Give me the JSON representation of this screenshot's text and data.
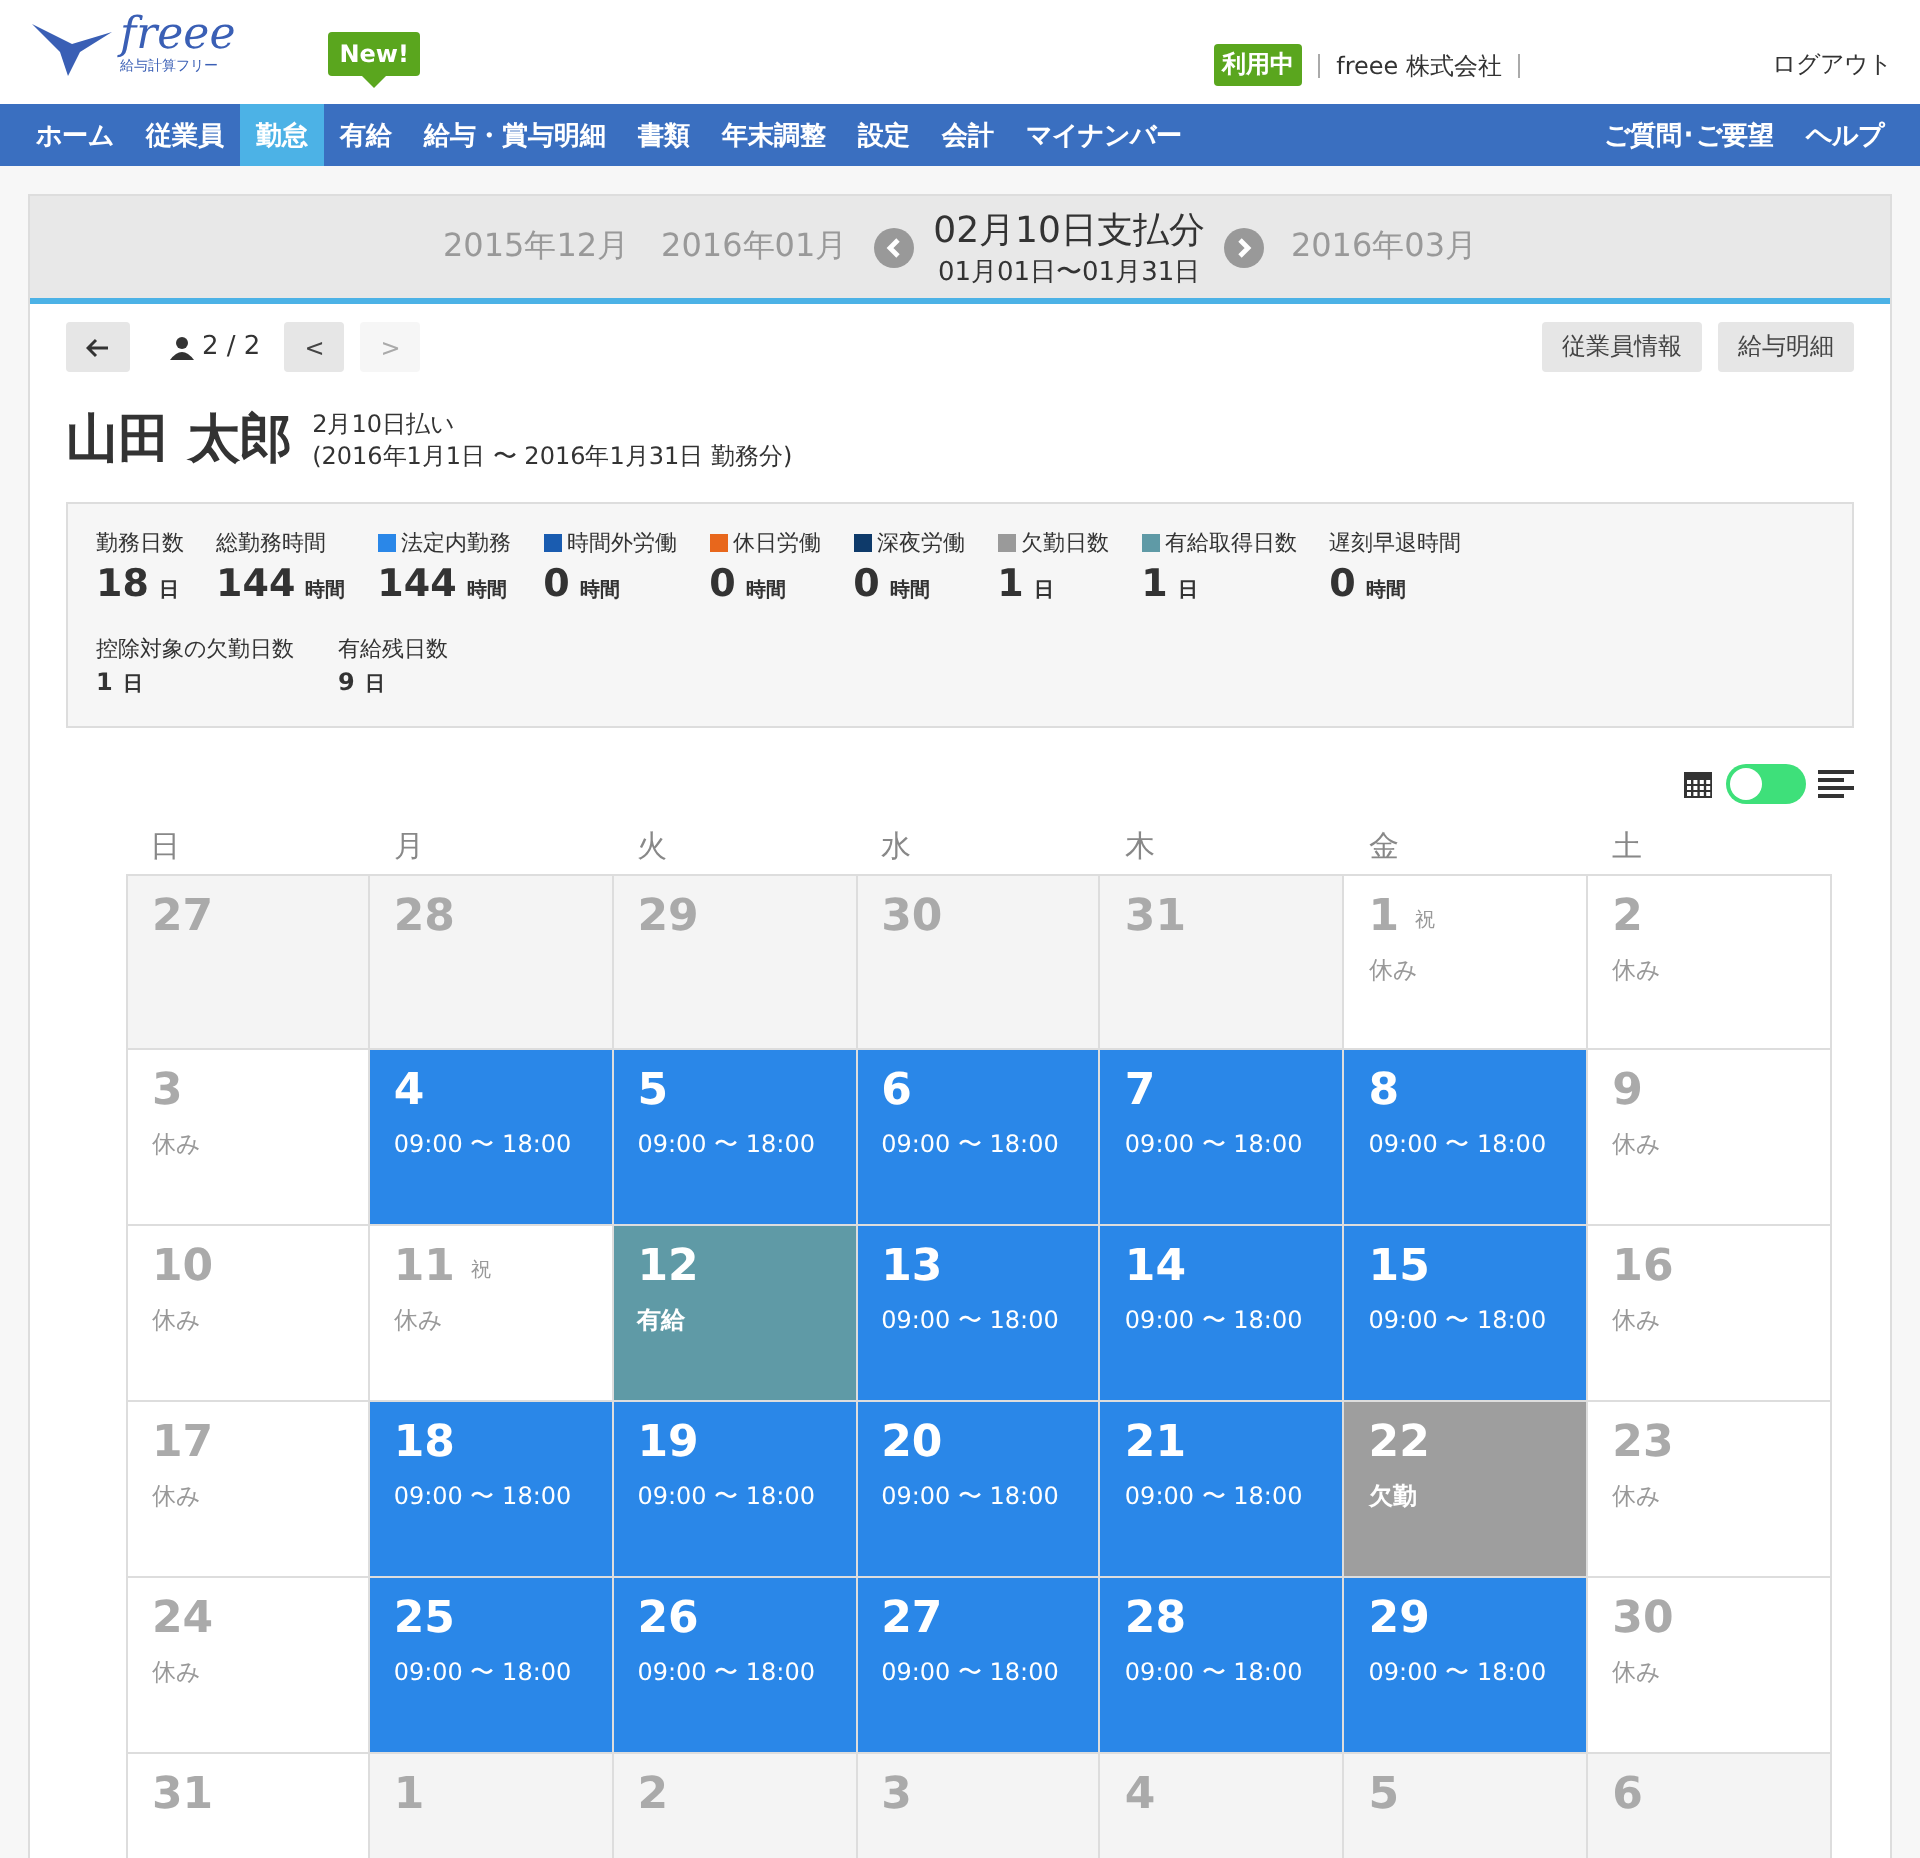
{
  "header": {
    "logo_text": "freee",
    "logo_sub": "給与計算フリー",
    "status_badge": "利用中",
    "company": "freee 株式会社",
    "logout": "ログアウト",
    "new_badge": "New!"
  },
  "nav": {
    "items": [
      {
        "label": "ホーム",
        "selected": false
      },
      {
        "label": "従業員",
        "selected": false
      },
      {
        "label": "勤怠",
        "selected": true
      },
      {
        "label": "有給",
        "selected": false
      },
      {
        "label": "給与・賞与明細",
        "selected": false
      },
      {
        "label": "書類",
        "selected": false
      },
      {
        "label": "年末調整",
        "selected": false
      },
      {
        "label": "設定",
        "selected": false
      },
      {
        "label": "会計",
        "selected": false
      },
      {
        "label": "マイナンバー",
        "selected": false
      }
    ],
    "right_items": [
      {
        "label": "ご質問･ご要望",
        "selected": false
      },
      {
        "label": "ヘルプ",
        "selected": false
      }
    ]
  },
  "period": {
    "prev": [
      "2015年12月",
      "2016年01月"
    ],
    "title": "02月10日支払分",
    "range": "01月01日〜01月31日",
    "next": [
      "2016年03月"
    ]
  },
  "toolbar": {
    "pager": "2 / 2",
    "prev": "<",
    "next": ">",
    "buttons": [
      "従業員情報",
      "給与明細"
    ]
  },
  "employee": {
    "name": "山田 太郎",
    "pay_date": "2月10日払い",
    "work_period": "(2016年1月1日 〜 2016年1月31日 勤務分)"
  },
  "summary": [
    {
      "label": "勤務日数",
      "value": "18",
      "unit": "日"
    },
    {
      "label": "総勤務時間",
      "value": "144",
      "unit": "時間"
    },
    {
      "label": "法定内勤務",
      "value": "144",
      "unit": "時間",
      "color": "#2a87e8"
    },
    {
      "label": "時間外労働",
      "value": "0",
      "unit": "時間",
      "color": "#1a5cb0"
    },
    {
      "label": "休日労働",
      "value": "0",
      "unit": "時間",
      "color": "#e8671c"
    },
    {
      "label": "深夜労働",
      "value": "0",
      "unit": "時間",
      "color": "#0e3a6a"
    },
    {
      "label": "欠勤日数",
      "value": "1",
      "unit": "日",
      "color": "#9a9a9a"
    },
    {
      "label": "有給取得日数",
      "value": "1",
      "unit": "日",
      "color": "#5f9aa6"
    },
    {
      "label": "遅刻早退時間",
      "value": "0",
      "unit": "時間"
    }
  ],
  "summary_extra": [
    {
      "label": "控除対象の欠勤日数",
      "value": "1",
      "unit": "日"
    },
    {
      "label": "有給残日数",
      "value": "9",
      "unit": "日"
    }
  ],
  "view_toggle": {
    "list_view": false
  },
  "weekdays": [
    "日",
    "月",
    "火",
    "水",
    "木",
    "金",
    "土"
  ],
  "weeks": [
    [
      {
        "day": "27",
        "kind": "other"
      },
      {
        "day": "28",
        "kind": "other"
      },
      {
        "day": "29",
        "kind": "other"
      },
      {
        "day": "30",
        "kind": "other"
      },
      {
        "day": "31",
        "kind": "other"
      },
      {
        "day": "1",
        "kind": "off",
        "holiday": "祝",
        "note": "休み"
      },
      {
        "day": "2",
        "kind": "off",
        "note": "休み"
      }
    ],
    [
      {
        "day": "3",
        "kind": "off",
        "note": "休み"
      },
      {
        "day": "4",
        "kind": "work",
        "note": "09:00 〜 18:00"
      },
      {
        "day": "5",
        "kind": "work",
        "note": "09:00 〜 18:00"
      },
      {
        "day": "6",
        "kind": "work",
        "note": "09:00 〜 18:00"
      },
      {
        "day": "7",
        "kind": "work",
        "note": "09:00 〜 18:00"
      },
      {
        "day": "8",
        "kind": "work",
        "note": "09:00 〜 18:00"
      },
      {
        "day": "9",
        "kind": "off",
        "note": "休み"
      }
    ],
    [
      {
        "day": "10",
        "kind": "off",
        "note": "休み"
      },
      {
        "day": "11",
        "kind": "off",
        "holiday": "祝",
        "note": "休み"
      },
      {
        "day": "12",
        "kind": "paid",
        "note": "有給"
      },
      {
        "day": "13",
        "kind": "work",
        "note": "09:00 〜 18:00"
      },
      {
        "day": "14",
        "kind": "work",
        "note": "09:00 〜 18:00"
      },
      {
        "day": "15",
        "kind": "work",
        "note": "09:00 〜 18:00"
      },
      {
        "day": "16",
        "kind": "off",
        "note": "休み"
      }
    ],
    [
      {
        "day": "17",
        "kind": "off",
        "note": "休み"
      },
      {
        "day": "18",
        "kind": "work",
        "note": "09:00 〜 18:00"
      },
      {
        "day": "19",
        "kind": "work",
        "note": "09:00 〜 18:00"
      },
      {
        "day": "20",
        "kind": "work",
        "note": "09:00 〜 18:00"
      },
      {
        "day": "21",
        "kind": "work",
        "note": "09:00 〜 18:00"
      },
      {
        "day": "22",
        "kind": "absent",
        "note": "欠勤"
      },
      {
        "day": "23",
        "kind": "off",
        "note": "休み"
      }
    ],
    [
      {
        "day": "24",
        "kind": "off",
        "note": "休み"
      },
      {
        "day": "25",
        "kind": "work",
        "note": "09:00 〜 18:00"
      },
      {
        "day": "26",
        "kind": "work",
        "note": "09:00 〜 18:00"
      },
      {
        "day": "27",
        "kind": "work",
        "note": "09:00 〜 18:00"
      },
      {
        "day": "28",
        "kind": "work",
        "note": "09:00 〜 18:00"
      },
      {
        "day": "29",
        "kind": "work",
        "note": "09:00 〜 18:00"
      },
      {
        "day": "30",
        "kind": "off",
        "note": "休み"
      }
    ],
    [
      {
        "day": "31",
        "kind": "off"
      },
      {
        "day": "1",
        "kind": "other"
      },
      {
        "day": "2",
        "kind": "other"
      },
      {
        "day": "3",
        "kind": "other"
      },
      {
        "day": "4",
        "kind": "other"
      },
      {
        "day": "5",
        "kind": "other"
      },
      {
        "day": "6",
        "kind": "other"
      }
    ]
  ]
}
